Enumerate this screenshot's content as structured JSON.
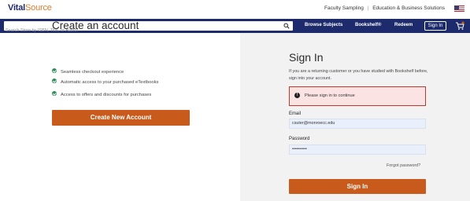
{
  "header": {
    "logo_part1": "Vital",
    "logo_part2": "Source",
    "link_faculty": "Faculty Sampling",
    "separator": "|",
    "link_education": "Education & Business Solutions",
    "flag_icon": "us-flag-icon"
  },
  "nav": {
    "search_placeholder": "Search Store by ISBN, Title, or Author",
    "search_icon": "search-icon",
    "browse": "Browse Subjects",
    "bookshelf": "Bookshelf®",
    "redeem": "Redeem",
    "signin": "Sign In",
    "cart_icon": "cart-icon"
  },
  "create": {
    "title": "Create an account",
    "features": [
      "Seamless checkout experience",
      "Automatic access to your purchased eTextbooks",
      "Access to offers and discounts for purchases"
    ],
    "button": "Create New Account"
  },
  "signin": {
    "title": "Sign In",
    "description": "If you are a returning customer or you have studied with Bookshelf before, sign into your account.",
    "alert": "Please sign in to continue",
    "email_label": "Email",
    "email_value": "csuter@monroecc.edu",
    "password_label": "Password",
    "password_value": "••••••••••",
    "forgot": "Forgot password?",
    "button": "Sign In"
  },
  "colors": {
    "navy": "#1d2a6b",
    "accent_orange": "#c85a1c",
    "logo_orange": "#e07b2b",
    "alert_bg": "#fbe3e4",
    "check_green": "#2e8b57"
  }
}
